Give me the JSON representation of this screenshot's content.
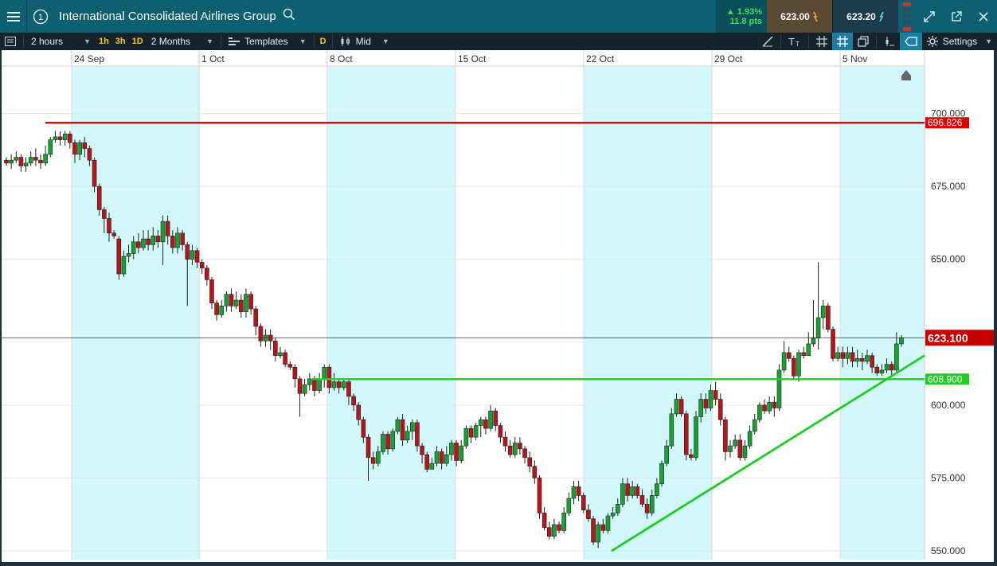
{
  "header": {
    "instrument_number": "1",
    "title": "International Consolidated Airlines Group",
    "change_pct": "▲ 1.93%",
    "change_pts": "11.8 pts",
    "sell_price": "623.00",
    "buy_price": "623.20"
  },
  "toolbar": {
    "interval": "2 hours",
    "quick_1h": "1h",
    "quick_3h": "3h",
    "quick_1d": "1D",
    "range": "2 Months",
    "templates": "Templates",
    "d_label": "D",
    "price_type": "Mid",
    "settings": "Settings"
  },
  "chart_data": {
    "type": "candlestick",
    "instrument": "International Consolidated Airlines Group",
    "x_ticks": [
      "24 Sep",
      "1 Oct",
      "8 Oct",
      "15 Oct",
      "22 Oct",
      "29 Oct",
      "5 Nov"
    ],
    "y_ticks": [
      "700.000",
      "675.000",
      "650.000",
      "600.000",
      "575.000",
      "550.000"
    ],
    "ylim": [
      547,
      716
    ],
    "candles": [
      [
        684,
        683,
        685,
        682
      ],
      [
        683,
        684,
        686,
        681
      ],
      [
        684,
        685,
        687,
        683
      ],
      [
        685,
        682,
        686,
        680
      ],
      [
        682,
        683,
        685,
        680
      ],
      [
        683,
        685,
        687,
        682
      ],
      [
        685,
        684,
        688,
        682
      ],
      [
        684,
        683,
        686,
        681
      ],
      [
        683,
        686,
        689,
        682
      ],
      [
        686,
        691,
        692,
        685
      ],
      [
        691,
        692,
        694,
        690
      ],
      [
        692,
        691,
        694,
        689
      ],
      [
        691,
        693,
        694,
        689
      ],
      [
        693,
        690,
        694,
        688
      ],
      [
        690,
        686,
        691,
        683
      ],
      [
        686,
        690,
        691,
        684
      ],
      [
        690,
        688,
        692,
        685
      ],
      [
        688,
        684,
        689,
        682
      ],
      [
        684,
        675,
        685,
        673
      ],
      [
        675,
        667,
        676,
        665
      ],
      [
        667,
        664,
        668,
        659
      ],
      [
        664,
        659,
        666,
        656
      ],
      [
        659,
        658,
        660,
        657
      ],
      [
        657,
        645,
        658,
        643
      ],
      [
        645,
        651,
        653,
        644
      ],
      [
        651,
        652,
        655,
        649
      ],
      [
        652,
        656,
        658,
        650
      ],
      [
        656,
        654,
        659,
        652
      ],
      [
        654,
        657,
        660,
        653
      ],
      [
        657,
        655,
        660,
        653
      ],
      [
        655,
        658,
        661,
        653
      ],
      [
        658,
        656,
        660,
        654
      ],
      [
        656,
        663,
        665,
        648
      ],
      [
        663,
        658,
        665,
        655
      ],
      [
        658,
        654,
        660,
        652
      ],
      [
        654,
        659,
        661,
        652
      ],
      [
        659,
        655,
        660,
        653
      ],
      [
        655,
        650,
        656,
        634
      ],
      [
        650,
        653,
        655,
        648
      ],
      [
        653,
        649,
        654,
        647
      ],
      [
        649,
        647,
        650,
        645
      ],
      [
        647,
        643,
        648,
        641
      ],
      [
        643,
        635,
        644,
        633
      ],
      [
        635,
        631,
        636,
        629
      ],
      [
        631,
        634,
        636,
        630
      ],
      [
        634,
        638,
        639,
        632
      ],
      [
        638,
        634,
        640,
        632
      ],
      [
        634,
        636,
        639,
        633
      ],
      [
        636,
        632,
        638,
        630
      ],
      [
        632,
        638,
        640,
        630
      ],
      [
        638,
        633,
        639,
        631
      ],
      [
        633,
        627,
        634,
        624
      ],
      [
        627,
        622,
        628,
        620
      ],
      [
        622,
        624,
        626,
        620
      ],
      [
        624,
        622,
        626,
        619
      ],
      [
        622,
        617,
        623,
        615
      ],
      [
        617,
        618,
        620,
        616
      ],
      [
        618,
        614,
        619,
        613
      ],
      [
        614,
        613,
        615,
        612
      ],
      [
        613,
        609,
        614,
        606
      ],
      [
        609,
        604,
        610,
        596
      ],
      [
        604,
        607,
        609,
        603
      ],
      [
        607,
        609,
        611,
        605
      ],
      [
        609,
        605,
        610,
        603
      ],
      [
        605,
        609,
        611,
        604
      ],
      [
        609,
        613,
        614,
        606
      ],
      [
        613,
        606,
        614,
        604
      ],
      [
        606,
        608,
        611,
        605
      ],
      [
        608,
        606,
        609,
        604
      ],
      [
        606,
        608,
        609,
        605
      ],
      [
        608,
        603,
        609,
        600
      ],
      [
        603,
        600,
        604,
        598
      ],
      [
        600,
        595,
        601,
        593
      ],
      [
        595,
        589,
        596,
        587
      ],
      [
        589,
        582,
        590,
        574
      ],
      [
        582,
        580,
        584,
        578
      ],
      [
        580,
        584,
        586,
        579
      ],
      [
        584,
        590,
        591,
        583
      ],
      [
        590,
        585,
        591,
        583
      ],
      [
        585,
        591,
        592,
        584
      ],
      [
        591,
        595,
        596,
        590
      ],
      [
        595,
        588,
        597,
        586
      ],
      [
        588,
        591,
        593,
        587
      ],
      [
        591,
        594,
        595,
        588
      ],
      [
        594,
        586,
        595,
        584
      ],
      [
        586,
        583,
        587,
        580
      ],
      [
        583,
        578,
        584,
        577
      ],
      [
        578,
        580,
        582,
        578
      ],
      [
        580,
        584,
        586,
        579
      ],
      [
        584,
        580,
        585,
        578
      ],
      [
        580,
        583,
        586,
        579
      ],
      [
        583,
        587,
        588,
        581
      ],
      [
        587,
        581,
        588,
        579
      ],
      [
        581,
        586,
        588,
        580
      ],
      [
        586,
        592,
        593,
        585
      ],
      [
        592,
        589,
        593,
        587
      ],
      [
        589,
        593,
        594,
        588
      ],
      [
        593,
        595,
        596,
        589
      ],
      [
        595,
        592,
        596,
        590
      ],
      [
        592,
        598,
        600,
        591
      ],
      [
        598,
        593,
        599,
        591
      ],
      [
        593,
        589,
        594,
        587
      ],
      [
        589,
        586,
        591,
        584
      ],
      [
        586,
        583,
        588,
        582
      ],
      [
        583,
        587,
        589,
        582
      ],
      [
        587,
        585,
        589,
        583
      ],
      [
        585,
        582,
        586,
        580
      ],
      [
        582,
        579,
        584,
        577
      ],
      [
        579,
        575,
        581,
        573
      ],
      [
        575,
        563,
        576,
        561
      ],
      [
        563,
        558,
        565,
        557
      ],
      [
        558,
        555,
        560,
        554
      ],
      [
        555,
        559,
        561,
        554
      ],
      [
        559,
        557,
        560,
        556
      ],
      [
        557,
        563,
        565,
        556
      ],
      [
        563,
        568,
        570,
        562
      ],
      [
        568,
        572,
        574,
        566
      ],
      [
        572,
        569,
        574,
        567
      ],
      [
        569,
        564,
        570,
        563
      ],
      [
        564,
        561,
        566,
        560
      ],
      [
        561,
        553,
        562,
        552
      ],
      [
        553,
        559,
        560,
        551
      ],
      [
        559,
        557,
        561,
        556
      ],
      [
        557,
        562,
        563,
        556
      ],
      [
        562,
        563,
        565,
        561
      ],
      [
        563,
        566,
        568,
        562
      ],
      [
        566,
        573,
        575,
        565
      ],
      [
        573,
        569,
        575,
        567
      ],
      [
        569,
        572,
        574,
        568
      ],
      [
        572,
        569,
        573,
        568
      ],
      [
        569,
        566,
        571,
        565
      ],
      [
        566,
        563,
        568,
        561
      ],
      [
        563,
        569,
        571,
        562
      ],
      [
        569,
        573,
        575,
        568
      ],
      [
        573,
        580,
        581,
        572
      ],
      [
        580,
        586,
        588,
        579
      ],
      [
        586,
        597,
        599,
        585
      ],
      [
        597,
        602,
        604,
        596
      ],
      [
        602,
        597,
        603,
        596
      ],
      [
        597,
        583,
        598,
        581
      ],
      [
        583,
        582,
        585,
        581
      ],
      [
        582,
        596,
        598,
        581
      ],
      [
        596,
        602,
        604,
        594
      ],
      [
        602,
        599,
        604,
        597
      ],
      [
        599,
        605,
        607,
        598
      ],
      [
        605,
        602,
        608,
        600
      ],
      [
        602,
        595,
        604,
        593
      ],
      [
        595,
        584,
        596,
        581
      ],
      [
        584,
        586,
        588,
        582
      ],
      [
        586,
        588,
        590,
        585
      ],
      [
        588,
        582,
        590,
        581
      ],
      [
        582,
        586,
        588,
        581
      ],
      [
        586,
        591,
        593,
        585
      ],
      [
        591,
        595,
        597,
        590
      ],
      [
        595,
        600,
        601,
        594
      ],
      [
        600,
        598,
        602,
        597
      ],
      [
        598,
        601,
        603,
        597
      ],
      [
        601,
        599,
        603,
        596
      ],
      [
        599,
        612,
        614,
        598
      ],
      [
        612,
        618,
        622,
        611
      ],
      [
        618,
        616,
        620,
        615
      ],
      [
        616,
        610,
        617,
        609
      ],
      [
        610,
        618,
        619,
        608
      ],
      [
        618,
        617,
        620,
        616
      ],
      [
        617,
        621,
        625,
        617
      ],
      [
        621,
        623,
        636,
        620
      ],
      [
        623,
        630,
        649,
        619
      ],
      [
        630,
        634,
        636,
        626
      ],
      [
        634,
        626,
        635,
        625
      ],
      [
        626,
        616,
        627,
        615
      ],
      [
        616,
        618,
        620,
        615
      ],
      [
        618,
        616,
        620,
        613
      ],
      [
        616,
        618,
        620,
        614
      ],
      [
        618,
        615,
        620,
        613
      ],
      [
        615,
        616,
        619,
        613
      ],
      [
        616,
        615,
        618,
        612
      ],
      [
        615,
        617,
        619,
        614
      ],
      [
        617,
        613,
        618,
        611
      ],
      [
        613,
        611,
        614,
        610
      ],
      [
        611,
        612,
        614,
        610
      ],
      [
        612,
        614,
        616,
        611
      ],
      [
        614,
        612,
        615,
        610
      ],
      [
        612,
        621,
        625,
        611
      ],
      [
        621,
        623,
        624,
        620
      ]
    ],
    "horizontal_lines": [
      {
        "value": 696.826,
        "label": "696.826",
        "color": "#e00000"
      },
      {
        "value": 608.9,
        "label": "608.900",
        "color": "#22cc22"
      }
    ],
    "trendline": {
      "from": [
        "22 Oct",
        550
      ],
      "to": [
        "5 Nov",
        617
      ],
      "color": "#22cc22"
    },
    "current_price": {
      "value": 623.1,
      "label": "623.100",
      "color": "#c80000"
    },
    "shaded_periods": [
      "24 Sep",
      "8 Oct",
      "22 Oct",
      "5 Nov"
    ],
    "colors": {
      "up": "#16a233",
      "down": "#b8141c",
      "shade": "#d2f8fb",
      "grid": "#e6e6e6"
    }
  }
}
